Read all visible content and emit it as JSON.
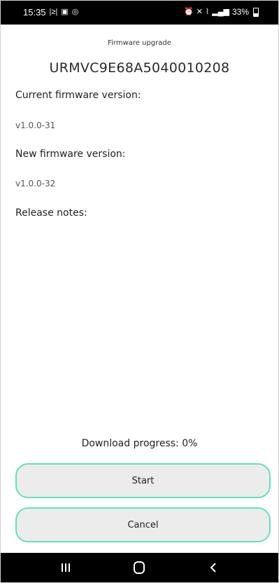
{
  "status_bar": {
    "time": "15:35",
    "left_icons": [
      "notification-icon",
      "image-icon",
      "whatsapp-icon"
    ],
    "right_icons": [
      "alarm-icon",
      "mute-icon",
      "wifi-call-icon",
      "signal-icon"
    ],
    "battery": "33%"
  },
  "screen": {
    "title": "Firmware upgrade",
    "device_id": "URMVC9E68A5040010208",
    "current_label": "Current firmware version:",
    "current_value": "v1.0.0-31",
    "new_label": "New firmware version:",
    "new_value": "v1.0.0-32",
    "notes_label": "Release notes:",
    "progress_label": "Download progress: 0%",
    "progress_value": 0
  },
  "buttons": {
    "start": "Start",
    "cancel": "Cancel"
  },
  "colors": {
    "accent": "#5fe0bf",
    "button_bg": "#ececec",
    "bars": "#000000"
  },
  "nav_bar": {
    "icons": [
      "recents-icon",
      "home-icon",
      "back-icon"
    ]
  }
}
